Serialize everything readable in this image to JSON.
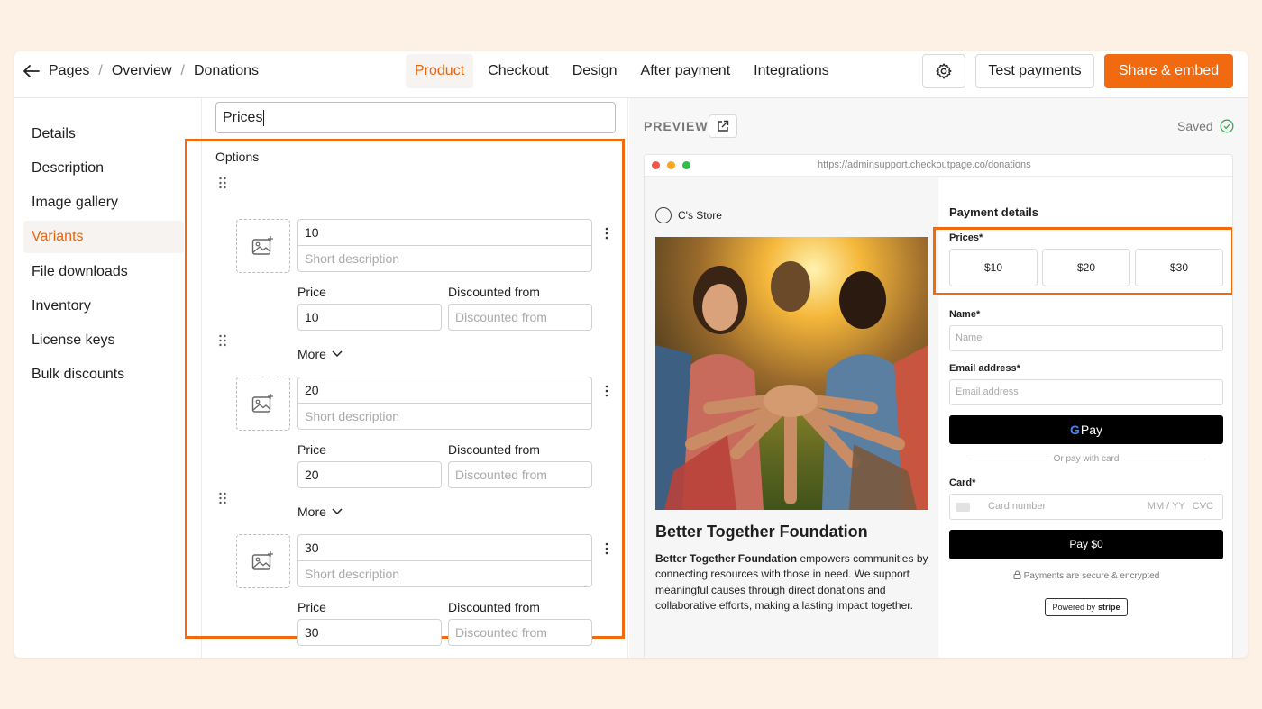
{
  "breadcrumb": [
    "Pages",
    "Overview",
    "Donations"
  ],
  "tabs": [
    {
      "label": "Product",
      "active": true
    },
    {
      "label": "Checkout",
      "active": false
    },
    {
      "label": "Design",
      "active": false
    },
    {
      "label": "After payment",
      "active": false
    },
    {
      "label": "Integrations",
      "active": false
    }
  ],
  "actions": {
    "test": "Test payments",
    "share": "Share & embed"
  },
  "sidebar": [
    "Details",
    "Description",
    "Image gallery",
    "Variants",
    "File downloads",
    "Inventory",
    "License keys",
    "Bulk discounts"
  ],
  "sidebar_active": "Variants",
  "editor": {
    "variant_name": "Prices",
    "options_label": "Options",
    "short_desc_placeholder": "Short description",
    "price_label": "Price",
    "discount_label": "Discounted from",
    "discount_placeholder": "Discounted from",
    "more_label": "More",
    "options": [
      {
        "name": "10",
        "price": "10"
      },
      {
        "name": "20",
        "price": "20"
      },
      {
        "name": "30",
        "price": "30"
      }
    ]
  },
  "preview": {
    "label": "PREVIEW",
    "saved": "Saved",
    "url": "https://adminsupport.checkoutpage.co/donations",
    "store_name": "C's Store",
    "product_title": "Better Together Foundation",
    "desc_bold": "Better Together Foundation",
    "desc_rest": " empowers communities by connecting resources with those in need. We support meaningful causes through direct donations and collaborative efforts, making a lasting impact together.",
    "payment_title": "Payment details",
    "prices_label": "Prices",
    "prices": [
      "$10",
      "$20",
      "$30"
    ],
    "name_label": "Name",
    "name_placeholder": "Name",
    "email_label": "Email address",
    "email_placeholder": "Email address",
    "gpay_label": "Pay",
    "or_text": "Or pay with card",
    "card_label": "Card",
    "card_placeholder": "Card number",
    "card_exp": "MM / YY",
    "card_cvc": "CVC",
    "pay_button": "Pay $0",
    "secure_text": "Payments are secure & encrypted",
    "powered_by": "Powered by",
    "stripe": "stripe"
  },
  "colors": {
    "accent": "#f26a10"
  }
}
